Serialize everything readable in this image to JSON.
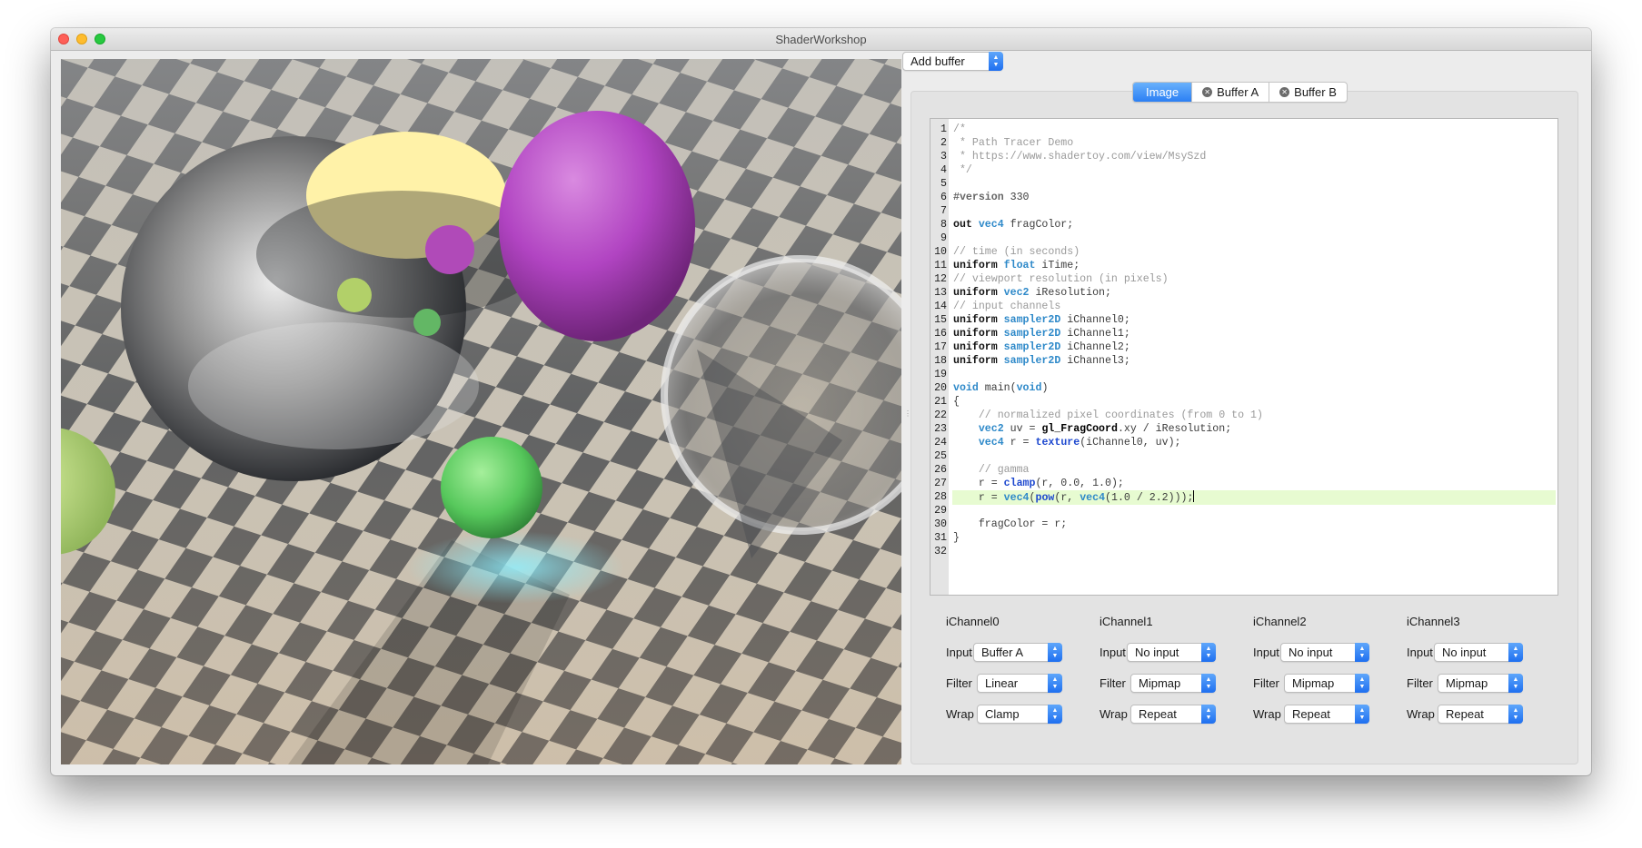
{
  "window": {
    "title": "ShaderWorkshop"
  },
  "toolbar": {
    "add_buffer_label": "Add buffer"
  },
  "tabs": [
    {
      "label": "Image",
      "active": true,
      "closable": false
    },
    {
      "label": "Buffer A",
      "active": false,
      "closable": true
    },
    {
      "label": "Buffer B",
      "active": false,
      "closable": true
    }
  ],
  "editor": {
    "highlight_line": 28,
    "lines": [
      [
        [
          "c",
          "/*"
        ]
      ],
      [
        [
          "c",
          " * Path Tracer Demo"
        ]
      ],
      [
        [
          "c",
          " * https://www.shadertoy.com/view/MsySzd"
        ]
      ],
      [
        [
          "c",
          " */"
        ]
      ],
      [],
      [
        [
          "p",
          "#version"
        ],
        [
          "t",
          " 330"
        ]
      ],
      [],
      [
        [
          "k",
          "out"
        ],
        [
          "t",
          " "
        ],
        [
          "y",
          "vec4"
        ],
        [
          "t",
          " fragColor;"
        ]
      ],
      [],
      [
        [
          "c",
          "// time (in seconds)"
        ]
      ],
      [
        [
          "k",
          "uniform"
        ],
        [
          "t",
          " "
        ],
        [
          "y",
          "float"
        ],
        [
          "t",
          " iTime;"
        ]
      ],
      [
        [
          "c",
          "// viewport resolution (in pixels)"
        ]
      ],
      [
        [
          "k",
          "uniform"
        ],
        [
          "t",
          " "
        ],
        [
          "y",
          "vec2"
        ],
        [
          "t",
          " iResolution;"
        ]
      ],
      [
        [
          "c",
          "// input channels"
        ]
      ],
      [
        [
          "k",
          "uniform"
        ],
        [
          "t",
          " "
        ],
        [
          "y",
          "sampler2D"
        ],
        [
          "t",
          " iChannel0;"
        ]
      ],
      [
        [
          "k",
          "uniform"
        ],
        [
          "t",
          " "
        ],
        [
          "y",
          "sampler2D"
        ],
        [
          "t",
          " iChannel1;"
        ]
      ],
      [
        [
          "k",
          "uniform"
        ],
        [
          "t",
          " "
        ],
        [
          "y",
          "sampler2D"
        ],
        [
          "t",
          " iChannel2;"
        ]
      ],
      [
        [
          "k",
          "uniform"
        ],
        [
          "t",
          " "
        ],
        [
          "y",
          "sampler2D"
        ],
        [
          "t",
          " iChannel3;"
        ]
      ],
      [],
      [
        [
          "y",
          "void"
        ],
        [
          "t",
          " main("
        ],
        [
          "y",
          "void"
        ],
        [
          "t",
          ")"
        ]
      ],
      [
        [
          "t",
          "{"
        ]
      ],
      [
        [
          "t",
          "    "
        ],
        [
          "c",
          "// normalized pixel coordinates (from 0 to 1)"
        ]
      ],
      [
        [
          "t",
          "    "
        ],
        [
          "y",
          "vec2"
        ],
        [
          "t",
          " uv = "
        ],
        [
          "b",
          "gl_FragCoord"
        ],
        [
          "t",
          ".xy / iResolution;"
        ]
      ],
      [
        [
          "t",
          "    "
        ],
        [
          "y",
          "vec4"
        ],
        [
          "t",
          " r = "
        ],
        [
          "f",
          "texture"
        ],
        [
          "t",
          "(iChannel0, uv);"
        ]
      ],
      [],
      [
        [
          "t",
          "    "
        ],
        [
          "c",
          "// gamma"
        ]
      ],
      [
        [
          "t",
          "    r = "
        ],
        [
          "f",
          "clamp"
        ],
        [
          "t",
          "(r, 0.0, 1.0);"
        ]
      ],
      [
        [
          "t",
          "    r = "
        ],
        [
          "y",
          "vec4"
        ],
        [
          "t",
          "("
        ],
        [
          "f",
          "pow"
        ],
        [
          "t",
          "(r, "
        ],
        [
          "y",
          "vec4"
        ],
        [
          "t",
          "(1.0 / 2.2)));"
        ]
      ],
      [],
      [
        [
          "t",
          "    fragColor = r;"
        ]
      ],
      [
        [
          "t",
          "}"
        ]
      ],
      []
    ]
  },
  "channels": [
    {
      "title": "iChannel0",
      "input_label": "Input",
      "input": "Buffer A",
      "filter_label": "Filter",
      "filter": "Linear",
      "wrap_label": "Wrap",
      "wrap": "Clamp"
    },
    {
      "title": "iChannel1",
      "input_label": "Input",
      "input": "No input",
      "filter_label": "Filter",
      "filter": "Mipmap",
      "wrap_label": "Wrap",
      "wrap": "Repeat"
    },
    {
      "title": "iChannel2",
      "input_label": "Input",
      "input": "No input",
      "filter_label": "Filter",
      "filter": "Mipmap",
      "wrap_label": "Wrap",
      "wrap": "Repeat"
    },
    {
      "title": "iChannel3",
      "input_label": "Input",
      "input": "No input",
      "filter_label": "Filter",
      "filter": "Mipmap",
      "wrap_label": "Wrap",
      "wrap": "Repeat"
    }
  ],
  "colors": {
    "accent": "#2b7ff4",
    "keyword": "#111111",
    "type": "#2e89c9",
    "function": "#1d48cf",
    "comment": "#9a9a9a",
    "current_line": "#e7fbd1"
  }
}
